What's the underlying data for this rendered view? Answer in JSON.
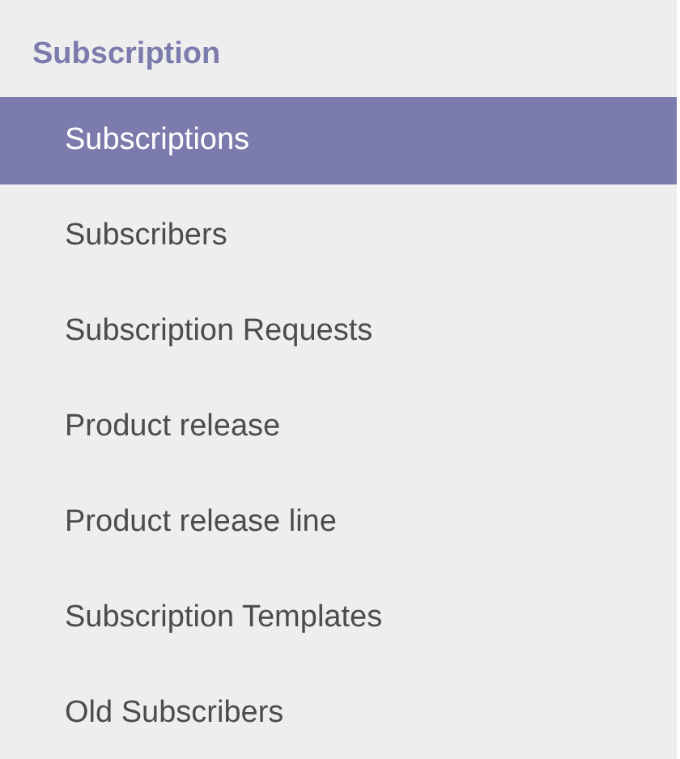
{
  "section": {
    "title": "Subscription"
  },
  "menu": [
    {
      "label": "Subscriptions",
      "selected": true
    },
    {
      "label": "Subscribers",
      "selected": false
    },
    {
      "label": "Subscription Requests",
      "selected": false
    },
    {
      "label": "Product release",
      "selected": false
    },
    {
      "label": "Product release line",
      "selected": false
    },
    {
      "label": "Subscription Templates",
      "selected": false
    },
    {
      "label": "Old Subscribers",
      "selected": false
    }
  ]
}
